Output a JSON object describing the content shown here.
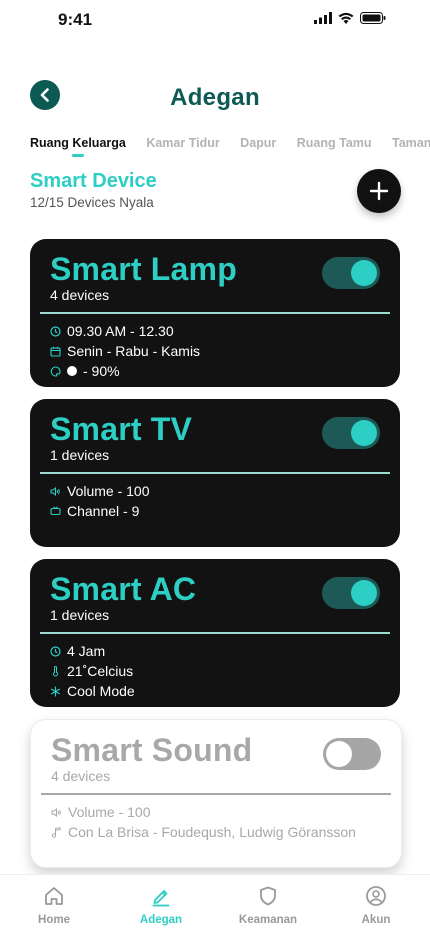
{
  "status_bar": {
    "time": "9:41"
  },
  "header": {
    "title": "Adegan"
  },
  "tabs": [
    {
      "label": "Ruang Keluarga",
      "active": true
    },
    {
      "label": "Kamar Tidur"
    },
    {
      "label": "Dapur"
    },
    {
      "label": "Ruang Tamu"
    },
    {
      "label": "Taman"
    }
  ],
  "section": {
    "title": "Smart Device",
    "subtitle": "12/15 Devices Nyala"
  },
  "devices": [
    {
      "name": "Smart Lamp",
      "devices": "4 devices",
      "on": true,
      "details": [
        {
          "icon": "clock-icon",
          "text": "09.30 AM - 12.30"
        },
        {
          "icon": "calendar-icon",
          "text": "Senin - Rabu - Kamis"
        },
        {
          "icon": "palette-icon",
          "text": "- 90%"
        }
      ]
    },
    {
      "name": "Smart TV",
      "devices": "1 devices",
      "on": true,
      "details": [
        {
          "icon": "volume-icon",
          "text": "Volume  - 100"
        },
        {
          "icon": "tv-icon",
          "text": "Channel - 9"
        }
      ]
    },
    {
      "name": "Smart AC",
      "devices": "1 devices",
      "on": true,
      "details": [
        {
          "icon": "clock-icon",
          "text": "4 Jam"
        },
        {
          "icon": "thermometer-icon",
          "text": "21˚Celcius"
        },
        {
          "icon": "snowflake-icon",
          "text": "Cool Mode"
        }
      ]
    },
    {
      "name": "Smart Sound",
      "devices": "4 devices",
      "on": false,
      "details": [
        {
          "icon": "volume-icon",
          "text": "Volume  - 100"
        },
        {
          "icon": "music-note-icon",
          "text": "Con La Brisa - Foudeqush, Ludwig Göransson"
        }
      ]
    }
  ],
  "bottom_nav": [
    {
      "label": "Home",
      "icon": "home-icon"
    },
    {
      "label": "Adegan",
      "icon": "edit-icon",
      "active": true
    },
    {
      "label": "Keamanan",
      "icon": "shield-icon"
    },
    {
      "label": "Akun",
      "icon": "user-icon"
    }
  ],
  "colors": {
    "accent": "#2dcfc5",
    "dark_teal": "#0d5a55",
    "card_dark": "#121212",
    "off_gray": "#a8a8a8"
  }
}
